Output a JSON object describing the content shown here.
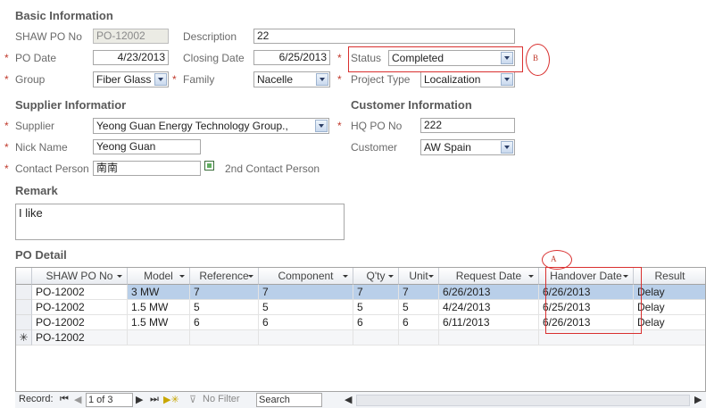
{
  "basic": {
    "title": "Basic Information",
    "shaw_po_label": "SHAW PO No",
    "shaw_po_value": "PO-12002",
    "description_label": "Description",
    "description_value": "22",
    "po_date_label": "PO Date",
    "po_date_value": "4/23/2013",
    "closing_date_label": "Closing Date",
    "closing_date_value": "6/25/2013",
    "status_label": "Status",
    "status_value": "Completed",
    "group_label": "Group",
    "group_value": "Fiber Glass",
    "family_label": "Family",
    "family_value": "Nacelle",
    "project_type_label": "Project Type",
    "project_type_value": "Localization",
    "required_mark": "*"
  },
  "supplier": {
    "title": "Supplier Informatior",
    "supplier_label": "Supplier",
    "supplier_value": "Yeong Guan Energy Technology Group.,",
    "nick_name_label": "Nick Name",
    "nick_name_value": "Yeong Guan",
    "contact_label": "Contact Person",
    "contact_value": "南南",
    "second_contact_label": "2nd Contact Person"
  },
  "customer": {
    "title": "Customer Information",
    "hq_po_label": "HQ PO No",
    "hq_po_value": "222",
    "customer_label": "Customer",
    "customer_value": "AW Spain"
  },
  "remark": {
    "title": "Remark",
    "value": "I like"
  },
  "annotations": {
    "a": "A",
    "b": "B",
    "color": "#d9302f"
  },
  "po_detail": {
    "title": "PO Detail",
    "columns": [
      "SHAW PO No",
      "Model",
      "Reference",
      "Component",
      "Q'ty",
      "Unit",
      "Request Date",
      "Handover Date",
      "Result"
    ],
    "rows": [
      [
        "PO-12002",
        "3 MW",
        "7",
        "7",
        "7",
        "7",
        "6/26/2013",
        "6/26/2013",
        "Delay"
      ],
      [
        "PO-12002",
        "1.5 MW",
        "5",
        "5",
        "5",
        "5",
        "4/24/2013",
        "6/25/2013",
        "Delay"
      ],
      [
        "PO-12002",
        "1.5 MW",
        "6",
        "6",
        "6",
        "6",
        "6/11/2013",
        "6/26/2013",
        "Delay"
      ],
      [
        "PO-12002",
        "",
        "",
        "",
        "",
        "",
        "",
        "",
        ""
      ]
    ],
    "new_row_marker": "✳",
    "selected_row_color": "#b9cfe9"
  },
  "navigator": {
    "record_label": "Record:",
    "record_value": "1 of 3",
    "filter_label": "No Filter",
    "search_placeholder": "Search"
  }
}
